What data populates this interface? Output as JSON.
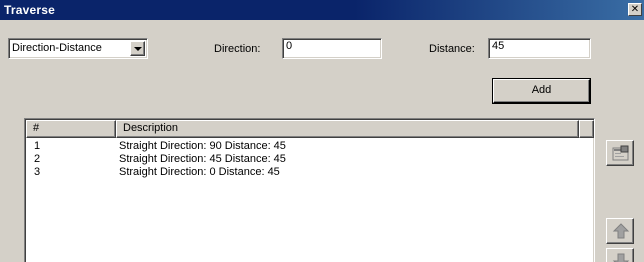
{
  "window": {
    "title": "Traverse",
    "close_glyph": "✕"
  },
  "form": {
    "method_select": {
      "value": "Direction-Distance"
    },
    "direction": {
      "label": "Direction:",
      "value": "0"
    },
    "distance": {
      "label": "Distance:",
      "value": "45"
    },
    "add_label": "Add"
  },
  "list": {
    "columns": [
      "#",
      "Description"
    ],
    "rows": [
      {
        "num": "1",
        "desc": "Straight  Direction: 90  Distance: 45"
      },
      {
        "num": "2",
        "desc": "Straight  Direction: 45  Distance: 45"
      },
      {
        "num": "3",
        "desc": "Straight  Direction: 0  Distance: 45"
      }
    ]
  },
  "side_buttons": {
    "properties": {
      "icon": "properties-icon"
    },
    "move_up": {
      "icon": "arrow-up-icon"
    },
    "move_down": {
      "icon": "arrow-down-icon"
    }
  }
}
